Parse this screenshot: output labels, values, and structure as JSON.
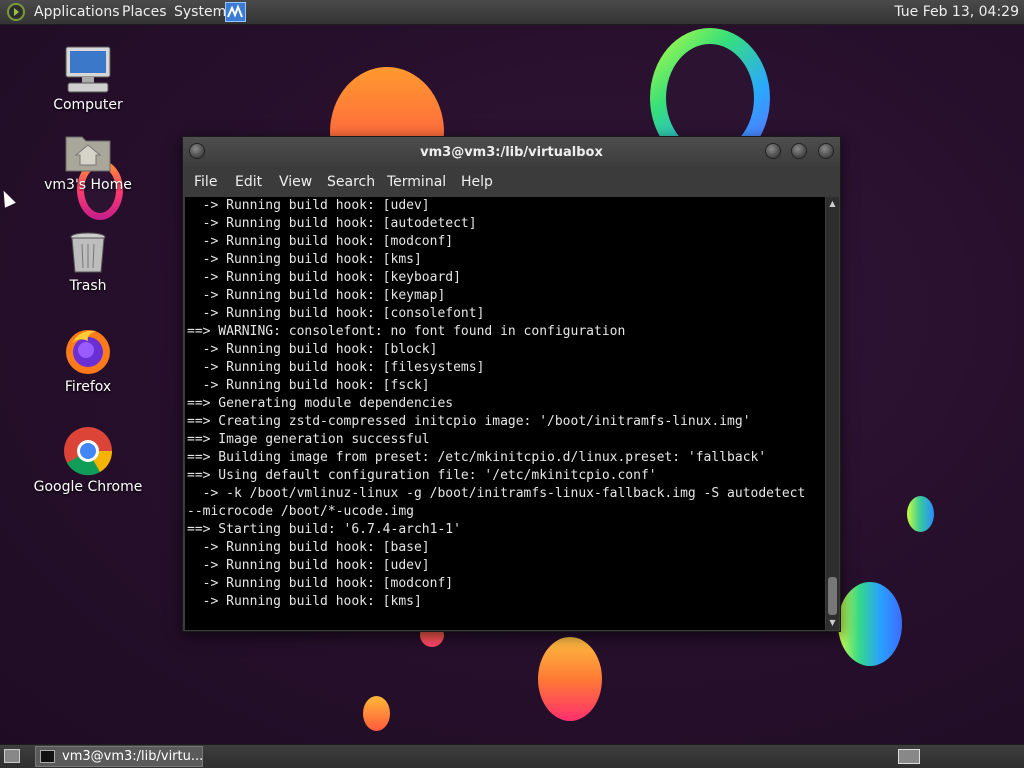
{
  "top_panel": {
    "menus": [
      "Applications",
      "Places",
      "System"
    ],
    "clock": "Tue Feb 13, 04:29"
  },
  "desktop_icons": [
    {
      "label": "Computer",
      "icon": "computer-icon"
    },
    {
      "label": "vm3's Home",
      "icon": "home-folder-icon"
    },
    {
      "label": "Trash",
      "icon": "trash-icon"
    },
    {
      "label": "Firefox",
      "icon": "firefox-icon"
    },
    {
      "label": "Google Chrome",
      "icon": "chrome-icon"
    }
  ],
  "terminal": {
    "title": "vm3@vm3:/lib/virtualbox",
    "menu": [
      "File",
      "Edit",
      "View",
      "Search",
      "Terminal",
      "Help"
    ],
    "lines": [
      "  -> Running build hook: [udev]",
      "  -> Running build hook: [autodetect]",
      "  -> Running build hook: [modconf]",
      "  -> Running build hook: [kms]",
      "  -> Running build hook: [keyboard]",
      "  -> Running build hook: [keymap]",
      "  -> Running build hook: [consolefont]",
      "==> WARNING: consolefont: no font found in configuration",
      "  -> Running build hook: [block]",
      "  -> Running build hook: [filesystems]",
      "  -> Running build hook: [fsck]",
      "==> Generating module dependencies",
      "==> Creating zstd-compressed initcpio image: '/boot/initramfs-linux.img'",
      "==> Image generation successful",
      "==> Building image from preset: /etc/mkinitcpio.d/linux.preset: 'fallback'",
      "==> Using default configuration file: '/etc/mkinitcpio.conf'",
      "  -> -k /boot/vmlinuz-linux -g /boot/initramfs-linux-fallback.img -S autodetect",
      "--microcode /boot/*-ucode.img",
      "==> Starting build: '6.7.4-arch1-1'",
      "  -> Running build hook: [base]",
      "  -> Running build hook: [udev]",
      "  -> Running build hook: [modconf]",
      "  -> Running build hook: [kms]"
    ]
  },
  "taskbar": {
    "task_label": "vm3@vm3:/lib/virtu..."
  }
}
